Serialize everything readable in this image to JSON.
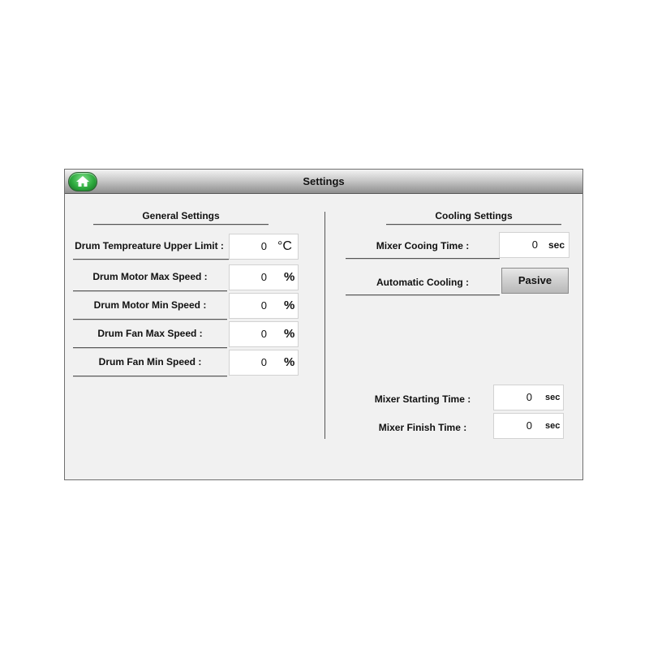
{
  "window": {
    "title": "Settings",
    "home_icon": "home-icon"
  },
  "general": {
    "title": "General Settings",
    "rows": [
      {
        "label": "Drum Tempreature Upper Limit :",
        "value": "0",
        "unit": "°C"
      },
      {
        "label": "Drum Motor Max Speed :",
        "value": "0",
        "unit": "%"
      },
      {
        "label": "Drum Motor Min Speed :",
        "value": "0",
        "unit": "%"
      },
      {
        "label": "Drum Fan Max Speed :",
        "value": "0",
        "unit": "%"
      },
      {
        "label": "Drum Fan Min Speed :",
        "value": "0",
        "unit": "%"
      }
    ]
  },
  "cooling": {
    "title": "Cooling Settings",
    "mixer_cooling_time": {
      "label": "Mixer Cooing Time :",
      "value": "0",
      "unit": "sec"
    },
    "automatic_cooling": {
      "label": "Automatic Cooling :",
      "button": "Pasive"
    },
    "mixer_starting_time": {
      "label": "Mixer Starting Time :",
      "value": "0",
      "unit": "sec"
    },
    "mixer_finish_time": {
      "label": "Mixer Finish Time :",
      "value": "0",
      "unit": "sec"
    }
  },
  "colors": {
    "panel_bg": "#f1f1f1",
    "home_button": "#2eab3e"
  }
}
